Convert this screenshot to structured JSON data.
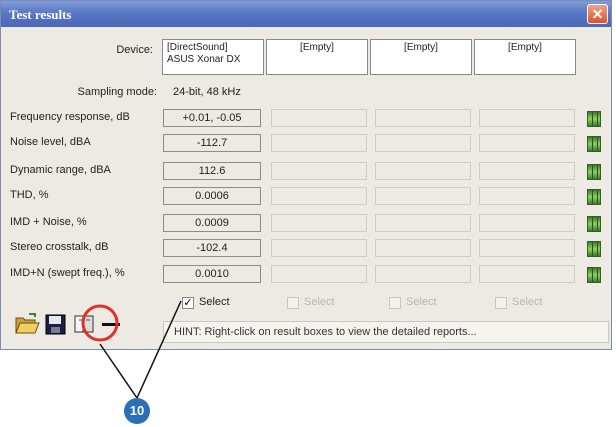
{
  "window": {
    "title": "Test results"
  },
  "device": {
    "label": "Device:",
    "columns": [
      {
        "line1": "[DirectSound]",
        "line2": "ASUS Xonar DX"
      },
      {
        "line1": "[Empty]",
        "line2": ""
      },
      {
        "line1": "[Empty]",
        "line2": ""
      },
      {
        "line1": "[Empty]",
        "line2": ""
      }
    ]
  },
  "sampling": {
    "label": "Sampling mode:",
    "value": "24-bit, 48 kHz"
  },
  "metrics": [
    {
      "label": "Frequency response, dB",
      "value": "+0.01, -0.05"
    },
    {
      "label": "Noise level, dBA",
      "value": "-112.7"
    },
    {
      "label": "Dynamic range, dBA",
      "value": "112.6"
    },
    {
      "label": "THD, %",
      "value": "0.0006"
    },
    {
      "label": "IMD + Noise, %",
      "value": "0.0009"
    },
    {
      "label": "Stereo crosstalk, dB",
      "value": "-102.4"
    },
    {
      "label": "IMD+N (swept freq.), %",
      "value": "0.0010"
    }
  ],
  "select": [
    {
      "label": "Select",
      "checked": true,
      "enabled": true
    },
    {
      "label": "Select",
      "checked": false,
      "enabled": false
    },
    {
      "label": "Select",
      "checked": false,
      "enabled": false
    },
    {
      "label": "Select",
      "checked": false,
      "enabled": false
    }
  ],
  "toolbar": {
    "icons": [
      "open-folder-icon",
      "save-icon",
      "compare-icon",
      "minus-icon"
    ]
  },
  "hint": "HINT: Right-click on result boxes to view the detailed reports...",
  "callout": {
    "number": "10",
    "color": "#2a6fb8"
  },
  "colors": {
    "titlebar": "#5a78c6",
    "close": "#d9522c",
    "highlight_circle": "#e0302a"
  }
}
